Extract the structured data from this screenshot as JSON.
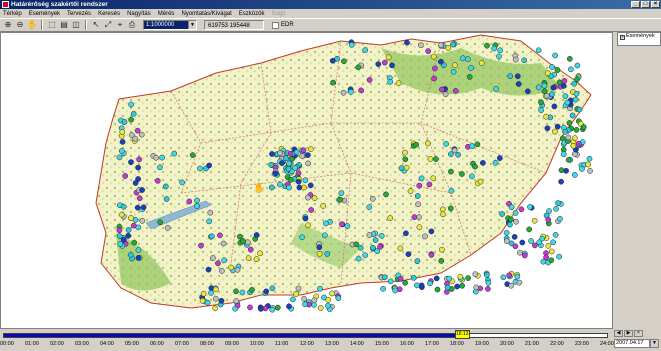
{
  "window": {
    "title": "Határérőség szakértői rendszer",
    "controls": [
      "_",
      "□",
      "×"
    ]
  },
  "menu": [
    "Térkép",
    "Események",
    "Tervezés",
    "Keresés",
    "Nagyítás",
    "Mérés",
    "Nyomtatás/Kivágat",
    "Eszközök",
    "Súgó"
  ],
  "toolbar": {
    "icons": [
      "zoom-in-icon",
      "zoom-out-icon",
      "pan-hand-icon",
      "select-icon",
      "layer-icon",
      "info-icon",
      "pointer-icon",
      "measure-icon",
      "route-icon",
      "print-icon"
    ],
    "scale_value": "1:1000000",
    "coordinates": "619753 195448",
    "edr_label": "EDR"
  },
  "side_panel": {
    "events_button": "Események"
  },
  "timebar": {
    "hours": [
      "00:00",
      "01:00",
      "02:00",
      "03:00",
      "04:00",
      "05:00",
      "06:00",
      "07:00",
      "08:00",
      "09:00",
      "10:00",
      "11:00",
      "12:00",
      "13:00",
      "14:00",
      "15:00",
      "16:00",
      "17:00",
      "18:00",
      "19:00",
      "20:00",
      "21:00",
      "22:00",
      "23:00",
      "24:00"
    ],
    "current_time": "18:13",
    "progress": 0.76,
    "date": "2007.04.17"
  }
}
